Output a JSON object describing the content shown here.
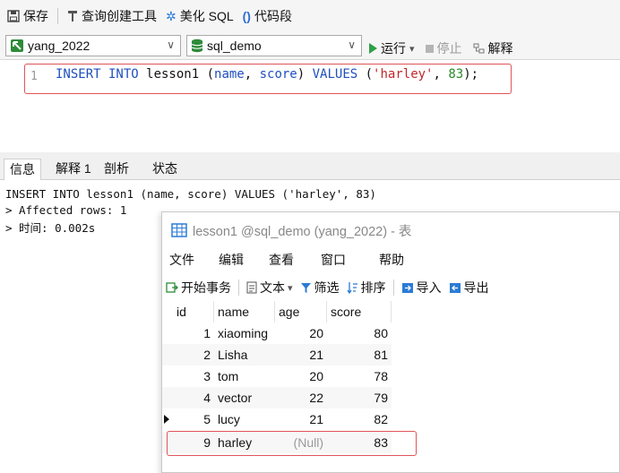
{
  "toolbar": {
    "save": "保存",
    "query_builder": "查询创建工具",
    "beautify": "美化 SQL",
    "snippet": "代码段"
  },
  "connection": {
    "connection_name": "yang_2022",
    "database_name": "sql_demo",
    "run": "运行",
    "run_dropdown": "▾",
    "stop": "停止",
    "explain": "解释"
  },
  "editor": {
    "line_number": "1",
    "sql_kw1": "INSERT INTO",
    "sql_table": " lesson1 (",
    "sql_col_name": "name",
    "sql_sep": ", ",
    "sql_col_score": "score",
    "sql_close": ") ",
    "sql_kw2": "VALUES",
    "sql_open": " (",
    "sql_str": "'harley'",
    "sql_sep2": ", ",
    "sql_num": "83",
    "sql_end": ");"
  },
  "result_tabs": [
    "信息",
    "解释 1",
    "剖析",
    "状态"
  ],
  "output": {
    "line1": "INSERT INTO lesson1 (name, score) VALUES ('harley', 83)",
    "line2": "> Affected rows: 1",
    "line3": "> 时间: 0.002s"
  },
  "table_window": {
    "title": "lesson1 @sql_demo (yang_2022) - 表",
    "menu": [
      "文件",
      "编辑",
      "查看",
      "窗口",
      "帮助"
    ],
    "tools": {
      "begin_tx": "开始事务",
      "text": "文本",
      "text_dropdown": "▾",
      "filter": "筛选",
      "sort": "排序",
      "import": "导入",
      "export": "导出"
    },
    "columns": [
      "id",
      "name",
      "age",
      "score"
    ],
    "rows": [
      {
        "id": "1",
        "name": "xiaoming",
        "age": "20",
        "score": "80"
      },
      {
        "id": "2",
        "name": "Lisha",
        "age": "21",
        "score": "81"
      },
      {
        "id": "3",
        "name": "tom",
        "age": "20",
        "score": "78"
      },
      {
        "id": "4",
        "name": "vector",
        "age": "22",
        "score": "79"
      },
      {
        "id": "5",
        "name": "lucy",
        "age": "21",
        "score": "82"
      },
      {
        "id": "9",
        "name": "harley",
        "age": "(Null)",
        "score": "83"
      }
    ]
  },
  "colors": {
    "highlight_border": "#e0555a",
    "keyword": "#1f4fbf",
    "string": "#c0282a",
    "number": "#2a8a2a"
  }
}
